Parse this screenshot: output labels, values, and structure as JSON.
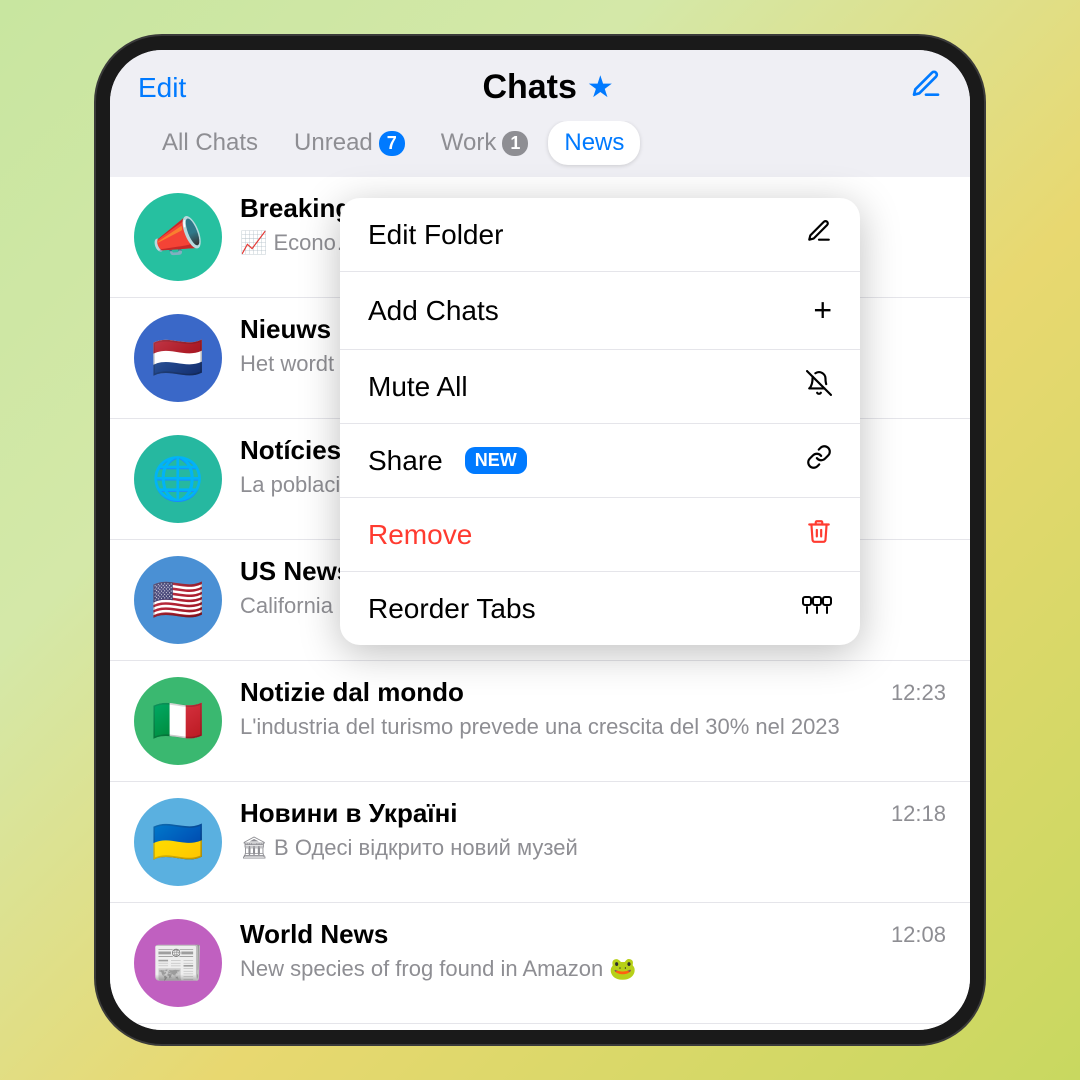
{
  "header": {
    "edit_label": "Edit",
    "title": "Chats",
    "star": "★",
    "compose_icon": "✏️"
  },
  "tabs": [
    {
      "id": "all",
      "label": "All Chats",
      "badge": null,
      "active": false
    },
    {
      "id": "unread",
      "label": "Unread",
      "badge": "7",
      "badge_color": "blue",
      "active": false
    },
    {
      "id": "work",
      "label": "Work",
      "badge": "1",
      "badge_color": "gray",
      "active": false
    },
    {
      "id": "news",
      "label": "News",
      "badge": null,
      "active": true
    }
  ],
  "chats": [
    {
      "id": 1,
      "name": "Breaking N…",
      "avatar_emoji": "📣",
      "avatar_class": "avatar-megaphone",
      "preview": "📈 Econo… growth ove…",
      "time": ""
    },
    {
      "id": 2,
      "name": "Nieuws in …",
      "avatar_emoji": "🇳🇱",
      "avatar_class": "avatar-dutch",
      "preview": "Het wordt v… week wordt…",
      "time": ""
    },
    {
      "id": 3,
      "name": "Notícies in…",
      "avatar_emoji": "🌐",
      "avatar_class": "avatar-globe",
      "preview": "La població… 750 milions…",
      "time": ""
    },
    {
      "id": 4,
      "name": "US News",
      "avatar_emoji": "🇺🇸",
      "avatar_class": "avatar-us",
      "preview": "California reservoirs hit highest levels in 3 years 💧",
      "time": ""
    },
    {
      "id": 5,
      "name": "Notizie dal mondo",
      "avatar_emoji": "🇮🇹",
      "avatar_class": "avatar-italy",
      "preview": "L'industria del turismo prevede una crescita del 30% nel 2023",
      "time": "12:23"
    },
    {
      "id": 6,
      "name": "Новини в Україні",
      "avatar_emoji": "🇺🇦",
      "avatar_class": "avatar-ukraine",
      "preview": "🏛 В Одесі відкрито новий музей",
      "time": "12:18"
    },
    {
      "id": 7,
      "name": "World News",
      "avatar_emoji": "📰",
      "avatar_class": "avatar-world",
      "preview": "New species of frog found in Amazon 🐸",
      "time": "12:08"
    }
  ],
  "menu": {
    "items": [
      {
        "id": "edit-folder",
        "label": "Edit Folder",
        "icon": "✏️",
        "icon_type": "edit",
        "red": false,
        "new_badge": false
      },
      {
        "id": "add-chats",
        "label": "Add Chats",
        "icon": "+",
        "icon_type": "plus",
        "red": false,
        "new_badge": false
      },
      {
        "id": "mute-all",
        "label": "Mute All",
        "icon": "🔕",
        "icon_type": "bell-off",
        "red": false,
        "new_badge": false
      },
      {
        "id": "share",
        "label": "Share",
        "icon": "🔗",
        "icon_type": "link",
        "red": false,
        "new_badge": true,
        "badge_label": "NEW"
      },
      {
        "id": "remove",
        "label": "Remove",
        "icon": "🗑",
        "icon_type": "trash",
        "red": true,
        "new_badge": false
      },
      {
        "id": "reorder-tabs",
        "label": "Reorder Tabs",
        "icon": "⠿",
        "icon_type": "reorder",
        "red": false,
        "new_badge": false
      }
    ]
  }
}
